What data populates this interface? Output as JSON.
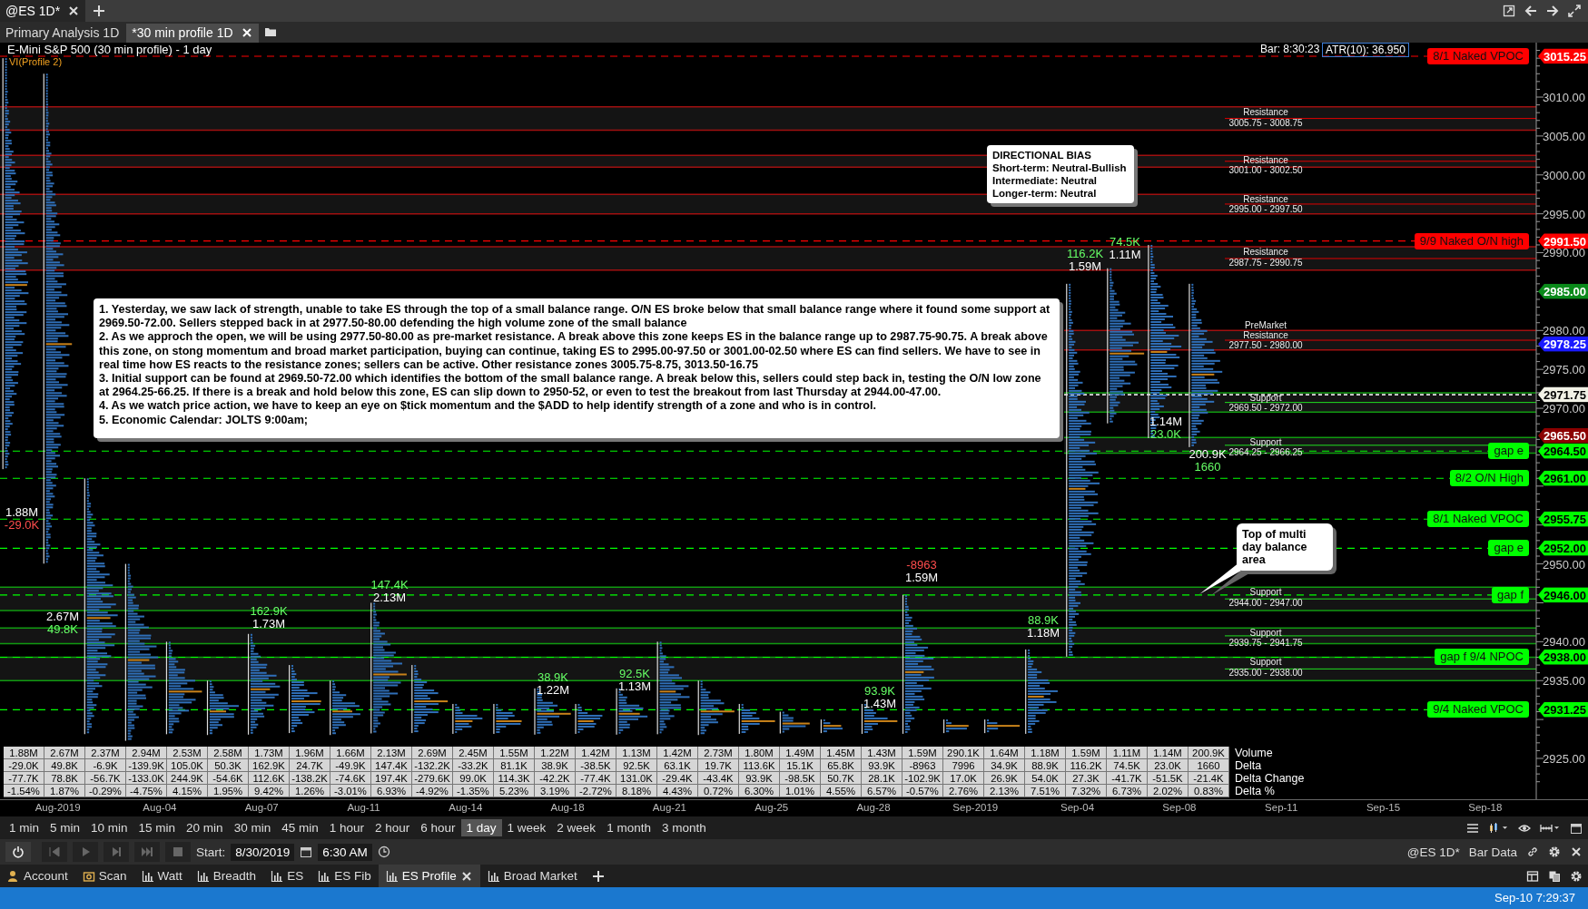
{
  "window_tabs": [
    {
      "label": "@ES 1D*",
      "selected": true
    }
  ],
  "page_tabs": [
    {
      "label": "Primary Analysis 1D",
      "selected": false
    },
    {
      "label": "*30 min profile 1D",
      "selected": true
    }
  ],
  "chart": {
    "title": "E-Mini S&P 500 (30 min profile) - 1 day",
    "study": "VI(Profile 2)",
    "bar_time": "Bar: 8:30:23",
    "atr": "ATR(10): 36.950",
    "zones": [
      {
        "kind": "resistance",
        "label": "Resistance",
        "range": "3005.75 - 3008.75"
      },
      {
        "kind": "resistance",
        "label": "Resistance",
        "range": "3001.00 - 3002.50"
      },
      {
        "kind": "resistance",
        "label": "Resistance",
        "range": "2995.00 - 2997.50"
      },
      {
        "kind": "resistance",
        "label": "Resistance",
        "range": "2987.75 - 2990.75"
      },
      {
        "kind": "resistance",
        "label": "PreMarket Resistance",
        "range": "2977.50 - 2980.00"
      },
      {
        "kind": "support",
        "label": "Support",
        "range": "2969.50 - 2972.00"
      },
      {
        "kind": "support",
        "label": "Support",
        "range": "2964.25 - 2966.25"
      },
      {
        "kind": "support",
        "label": "Support",
        "range": "2944.00 - 2947.00"
      },
      {
        "kind": "support",
        "label": "Support",
        "range": "2939.75 - 2941.75"
      },
      {
        "kind": "support",
        "label": "Support",
        "range": "2935.00 - 2938.00"
      }
    ],
    "markers": [
      {
        "label": "8/1 Naked VPOC",
        "price": "3015.25",
        "color": "#ff0000"
      },
      {
        "label": "9/9 Naked O/N high",
        "price": "2991.50",
        "color": "#ff0000"
      },
      {
        "label": "gap e",
        "price": "2964.50",
        "color": "#00ff00"
      },
      {
        "label": "8/2 O/N High",
        "price": "2961.00",
        "color": "#00ff00"
      },
      {
        "label": "8/1 Naked VPOC",
        "price": "2955.75",
        "color": "#00ff00"
      },
      {
        "label": "gap e",
        "price": "2952.00",
        "color": "#00ff00"
      },
      {
        "label": "gap f",
        "price": "2946.00",
        "color": "#00ff00"
      },
      {
        "label": "gap f 9/4 NPOC",
        "price": "2938.00",
        "color": "#00ff00"
      },
      {
        "label": "9/4 Naked VPOC",
        "price": "2931.25",
        "color": "#00ff00"
      }
    ],
    "price_tags": [
      {
        "price": "2985.00",
        "color": "#0a8a1a",
        "dashed_line": false
      },
      {
        "price": "2978.25",
        "color": "#1a1aff",
        "dashed_line": false
      },
      {
        "price": "2971.75",
        "color": "#f2f2e6",
        "dashed_line": true
      },
      {
        "price": "2965.50",
        "color": "#8b0000",
        "dashed_line": false
      }
    ],
    "price_axis": [
      "3010.00",
      "3005.00",
      "3000.00",
      "2995.00",
      "2990.00",
      "2980.00",
      "2975.00",
      "2970.00",
      "2950.00",
      "2940.00",
      "2935.00",
      "2925.00"
    ],
    "date_axis": [
      "Aug-2019",
      "Aug-04",
      "Aug-07",
      "Aug-11",
      "Aug-14",
      "Aug-18",
      "Aug-21",
      "Aug-25",
      "Aug-28",
      "Sep-2019",
      "Sep-04",
      "Sep-08",
      "Sep-11",
      "Sep-15",
      "Sep-18"
    ],
    "profile_labels": [
      {
        "lines": [
          {
            "text": "1.88M",
            "kind": "volume"
          },
          {
            "text": "-29.0K",
            "kind": "loss"
          }
        ]
      },
      {
        "lines": [
          {
            "text": "2.67M",
            "kind": "volume"
          },
          {
            "text": "49.8K",
            "kind": "gain"
          }
        ]
      },
      {
        "lines": [
          {
            "text": "162.9K",
            "kind": "gain"
          },
          {
            "text": "1.73M",
            "kind": "volume"
          }
        ]
      },
      {
        "lines": [
          {
            "text": "147.4K",
            "kind": "gain"
          },
          {
            "text": "2.13M",
            "kind": "volume"
          }
        ]
      },
      {
        "lines": [
          {
            "text": "38.9K",
            "kind": "gain"
          },
          {
            "text": "1.22M",
            "kind": "volume"
          }
        ]
      },
      {
        "lines": [
          {
            "text": "92.5K",
            "kind": "gain"
          },
          {
            "text": "1.13M",
            "kind": "volume"
          }
        ]
      },
      {
        "lines": [
          {
            "text": "93.9K",
            "kind": "gain"
          },
          {
            "text": "1.43M",
            "kind": "volume"
          }
        ]
      },
      {
        "lines": [
          {
            "text": "-8963",
            "kind": "loss"
          },
          {
            "text": "1.59M",
            "kind": "volume"
          }
        ]
      },
      {
        "lines": [
          {
            "text": "88.9K",
            "kind": "gain"
          },
          {
            "text": "1.18M",
            "kind": "volume"
          }
        ]
      },
      {
        "lines": [
          {
            "text": "116.2K",
            "kind": "gain"
          },
          {
            "text": "1.59M",
            "kind": "volume"
          }
        ]
      },
      {
        "lines": [
          {
            "text": "74.5K",
            "kind": "gain"
          },
          {
            "text": "1.11M",
            "kind": "volume"
          }
        ]
      },
      {
        "lines": [
          {
            "text": "1.14M",
            "kind": "volume"
          },
          {
            "text": "23.0K",
            "kind": "gain"
          }
        ]
      },
      {
        "lines": [
          {
            "text": "200.9K",
            "kind": "volume"
          },
          {
            "text": "1660",
            "kind": "gain"
          }
        ]
      }
    ],
    "note": [
      "1. Yesterday, we saw lack of strength, unable to take ES through the top of a small balance range.  O/N ES broke below that small balance range where it found some support at 2969.50-72.00. Sellers stepped back in at 2977.50-80.00 defending the high volume zone of the small balance",
      "2. As we approch the open, we will be using 2977.50-80.00 as pre-market resistance.  A break above this zone keeps ES in the balance range up to 2987.75-90.75.  A break above this zone, on stong momentum and broad market participation,  buying can continue, taking ES to 2995.00-97.50 or 3001.00-02.50 where ES can find sellers.  We have to see in real time how ES reacts to the resistance zones; sellers can be active.  Other resistance zones 3005.75-8.75, 3013.50-16.75",
      "3. Initial support can be found at 2969.50-72.00 which identifies the bottom of the small balance range.  A break below this, sellers could step back in, testing the O/N low zone at 2964.25-66.25.  If there is a break and hold below this zone,  ES can slip down to 2950-52, or even to test the breakout from last Thursday at 2944.00-47.00.",
      "4. As we watch price action, we have to keep an eye on $tick momentum and the $ADD to help identify strength of a zone and who is in control.",
      "5. Economic Calendar: JOLTS 9:00am;"
    ],
    "bias": [
      "DIRECTIONAL BIAS",
      "Short-term: Neutral-Bullish",
      "Intermediate: Neutral",
      "Longer-term: Neutral"
    ],
    "callout": "Top of multi day balance area",
    "table": [
      {
        "label": "Volume",
        "cells": [
          "1.88M",
          "2.67M",
          "2.37M",
          "2.94M",
          "2.53M",
          "2.58M",
          "1.73M",
          "1.96M",
          "1.66M",
          "2.13M",
          "2.69M",
          "2.45M",
          "1.55M",
          "1.22M",
          "1.42M",
          "1.13M",
          "1.42M",
          "2.73M",
          "1.80M",
          "1.49M",
          "1.45M",
          "1.43M",
          "1.59M",
          "290.1K",
          "1.64M",
          "1.18M",
          "1.59M",
          "1.11M",
          "1.14M",
          "200.9K"
        ]
      },
      {
        "label": "Delta",
        "cells": [
          "-29.0K",
          "49.8K",
          "-6.9K",
          "-139.9K",
          "105.0K",
          "50.3K",
          "162.9K",
          "24.7K",
          "-49.9K",
          "147.4K",
          "-132.2K",
          "-33.2K",
          "81.1K",
          "38.9K",
          "-38.5K",
          "92.5K",
          "63.1K",
          "19.7K",
          "113.6K",
          "15.1K",
          "65.8K",
          "93.9K",
          "-8963",
          "7996",
          "34.9K",
          "88.9K",
          "116.2K",
          "74.5K",
          "23.0K",
          "1660"
        ]
      },
      {
        "label": "Delta Change",
        "cells": [
          "-77.7K",
          "78.8K",
          "-56.7K",
          "-133.0K",
          "244.9K",
          "-54.6K",
          "112.6K",
          "-138.2K",
          "-74.6K",
          "197.4K",
          "-279.6K",
          "99.0K",
          "114.3K",
          "-42.2K",
          "-77.4K",
          "131.0K",
          "-29.4K",
          "-43.4K",
          "93.9K",
          "-98.5K",
          "50.7K",
          "28.1K",
          "-102.9K",
          "17.0K",
          "26.9K",
          "54.0K",
          "27.3K",
          "-41.7K",
          "-51.5K",
          "-21.4K"
        ]
      },
      {
        "label": "Delta %",
        "cells": [
          "-1.54%",
          "1.87%",
          "-0.29%",
          "-4.75%",
          "4.15%",
          "1.95%",
          "9.42%",
          "1.26%",
          "-3.01%",
          "6.93%",
          "-4.92%",
          "-1.35%",
          "5.23%",
          "3.19%",
          "-2.72%",
          "8.18%",
          "4.43%",
          "0.72%",
          "6.30%",
          "1.01%",
          "4.55%",
          "6.57%",
          "-0.57%",
          "2.76%",
          "2.13%",
          "7.51%",
          "7.32%",
          "6.73%",
          "2.02%",
          "0.83%"
        ]
      }
    ]
  },
  "timeframes": [
    {
      "label": "1 min",
      "selected": false
    },
    {
      "label": "5 min",
      "selected": false
    },
    {
      "label": "10 min",
      "selected": false
    },
    {
      "label": "15 min",
      "selected": false
    },
    {
      "label": "20 min",
      "selected": false
    },
    {
      "label": "30 min",
      "selected": false
    },
    {
      "label": "45 min",
      "selected": false
    },
    {
      "label": "1 hour",
      "selected": false
    },
    {
      "label": "2 hour",
      "selected": false
    },
    {
      "label": "6 hour",
      "selected": false
    },
    {
      "label": "1 day",
      "selected": true
    },
    {
      "label": "1 week",
      "selected": false
    },
    {
      "label": "2 week",
      "selected": false
    },
    {
      "label": "1 month",
      "selected": false
    },
    {
      "label": "3 month",
      "selected": false
    }
  ],
  "playback": {
    "start_label": "Start:",
    "date": "8/30/2019",
    "time": "6:30 AM",
    "symbol": "@ES 1D*",
    "mode": "Bar Data"
  },
  "bottom_tabs": [
    {
      "label": "Account",
      "kind": "account",
      "selected": false
    },
    {
      "label": "Scan",
      "kind": "scan",
      "selected": false
    },
    {
      "label": "Watt",
      "kind": "chart",
      "selected": false
    },
    {
      "label": "Breadth",
      "kind": "chart",
      "selected": false
    },
    {
      "label": "ES",
      "kind": "chart",
      "selected": false
    },
    {
      "label": "ES Fib",
      "kind": "chart",
      "selected": false
    },
    {
      "label": "ES Profile",
      "kind": "chart",
      "selected": true
    },
    {
      "label": "Broad Market",
      "kind": "chart",
      "selected": false
    }
  ],
  "status_bar": {
    "clock": "Sep-10 7:29:37"
  }
}
